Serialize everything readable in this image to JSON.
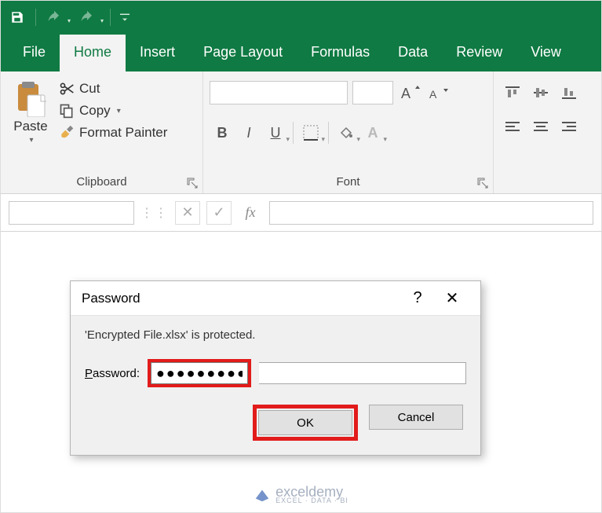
{
  "qat": {
    "customize_tip": "Customize"
  },
  "tabs": {
    "file": "File",
    "home": "Home",
    "insert": "Insert",
    "page_layout": "Page Layout",
    "formulas": "Formulas",
    "data": "Data",
    "review": "Review",
    "view": "View"
  },
  "ribbon": {
    "clipboard": {
      "paste": "Paste",
      "cut": "Cut",
      "copy": "Copy",
      "format_painter": "Format Painter",
      "group_label": "Clipboard"
    },
    "font": {
      "font_name": "",
      "font_size": "",
      "bold": "B",
      "italic": "I",
      "underline": "U",
      "font_color": "A",
      "group_label": "Font"
    }
  },
  "formula_bar": {
    "name_box": "",
    "cancel": "✕",
    "enter": "✓",
    "fx": "fx",
    "value": ""
  },
  "dialog": {
    "title": "Password",
    "help": "?",
    "close": "✕",
    "message": "'Encrypted File.xlsx' is protected.",
    "label_pre": "P",
    "label_post": "assword:",
    "value": "●●●●●●●●●",
    "ok": "OK",
    "cancel": "Cancel"
  },
  "watermark": {
    "brand": "exceldemy",
    "tagline": "EXCEL · DATA · BI"
  }
}
